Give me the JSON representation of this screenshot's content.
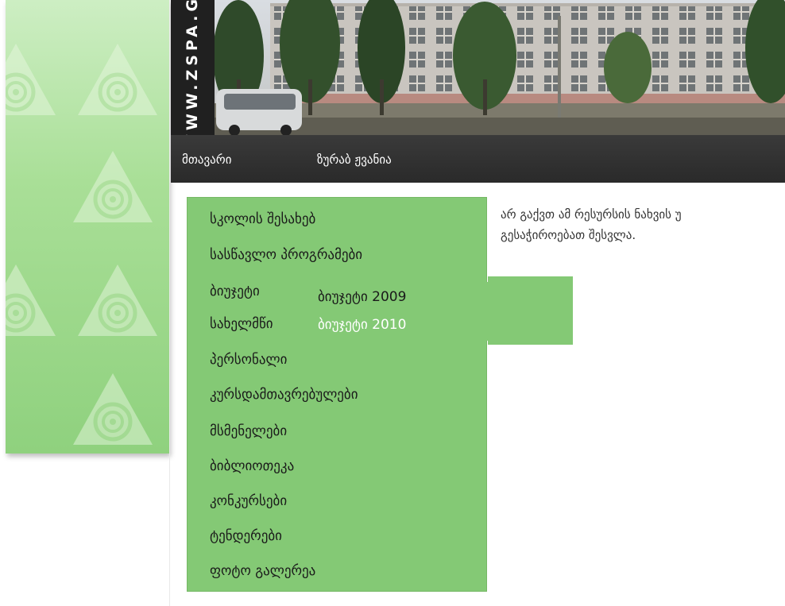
{
  "site": {
    "brand": "WWW.ZSPA.GE"
  },
  "nav": {
    "items": [
      {
        "label": "მთავარი"
      },
      {
        "label": "ზურაბ ჟვანია"
      }
    ]
  },
  "menu": {
    "items": [
      {
        "label": "სკოლის შესახებ"
      },
      {
        "label": "სასწავლო პროგრამები"
      },
      {
        "label": "ბიუჯეტი"
      },
      {
        "label": "სახელმწი"
      },
      {
        "label": "პერსონალი"
      },
      {
        "label": "კურსდამთავრებულები"
      },
      {
        "label": "მსმენელები"
      },
      {
        "label": "ბიბლიოთეკა"
      },
      {
        "label": "კონკურსები"
      },
      {
        "label": "ტენდერები"
      },
      {
        "label": "ფოტო გალერეა"
      }
    ]
  },
  "submenu": {
    "items": [
      {
        "label": "ბიუჯეტი 2009"
      },
      {
        "label": "ბიუჯეტი 2010"
      }
    ]
  },
  "notice": {
    "line1": "არ გაქვთ ამ რესურსის ნახვის უ",
    "line2": "გესაჭიროებათ შესვლა."
  },
  "colors": {
    "menu_bg": "#84c975",
    "nav_bg": "#2f2f2f",
    "submenu_text_normal": "#1a1a1a",
    "submenu_text_active": "#ffffff"
  }
}
